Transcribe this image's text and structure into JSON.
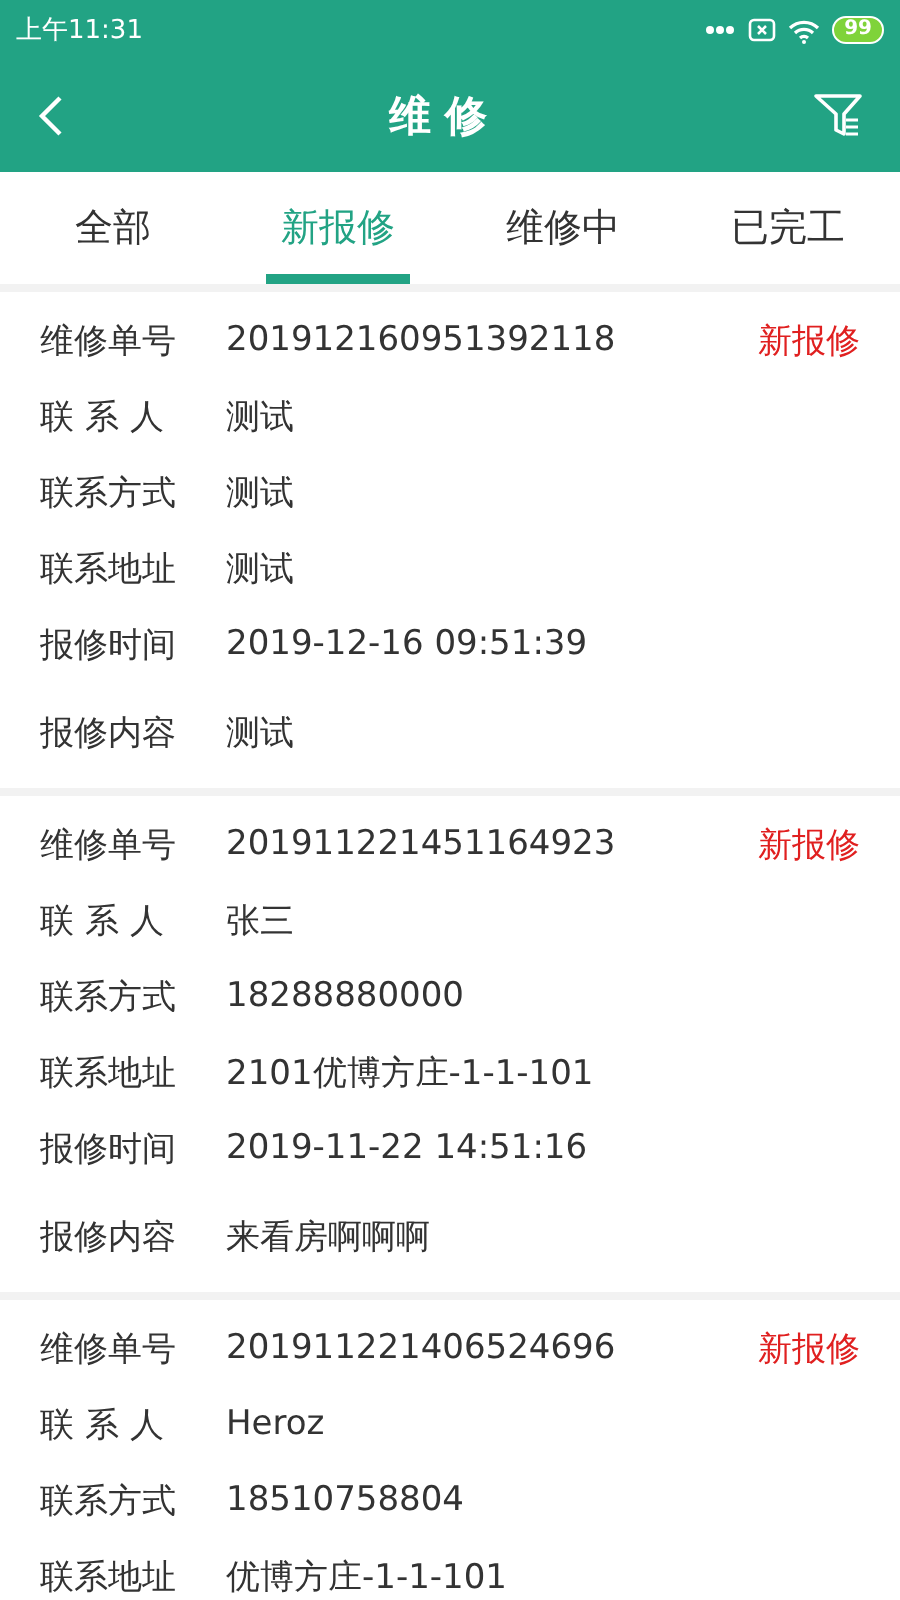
{
  "status_bar": {
    "time": "上午11:31",
    "battery": "99"
  },
  "header": {
    "title": "维 修"
  },
  "tabs": [
    {
      "label": "全部",
      "selected": false
    },
    {
      "label": "新报修",
      "selected": true
    },
    {
      "label": "维修中",
      "selected": false
    },
    {
      "label": "已完工",
      "selected": false
    }
  ],
  "orders": [
    {
      "status": "新报修",
      "fields": [
        {
          "label": "维修单号",
          "value": "201912160951392118"
        },
        {
          "label": "联 系 人",
          "value": "测试"
        },
        {
          "label": "联系方式",
          "value": "测试"
        },
        {
          "label": "联系地址",
          "value": "测试"
        },
        {
          "label": "报修时间",
          "value": "2019-12-16 09:51:39"
        },
        {
          "label": "报修内容",
          "value": "测试",
          "kind": "content"
        }
      ]
    },
    {
      "status": "新报修",
      "fields": [
        {
          "label": "维修单号",
          "value": "201911221451164923"
        },
        {
          "label": "联 系 人",
          "value": "张三"
        },
        {
          "label": "联系方式",
          "value": "18288880000"
        },
        {
          "label": "联系地址",
          "value": "2101优博方庄-1-1-101"
        },
        {
          "label": "报修时间",
          "value": "2019-11-22 14:51:16"
        },
        {
          "label": "报修内容",
          "value": "来看房啊啊啊",
          "kind": "content"
        }
      ]
    },
    {
      "status": "新报修",
      "fields": [
        {
          "label": "维修单号",
          "value": "201911221406524696"
        },
        {
          "label": "联 系 人",
          "value": "Heroz"
        },
        {
          "label": "联系方式",
          "value": "18510758804"
        },
        {
          "label": "联系地址",
          "value": "优博方庄-1-1-101"
        }
      ]
    }
  ]
}
